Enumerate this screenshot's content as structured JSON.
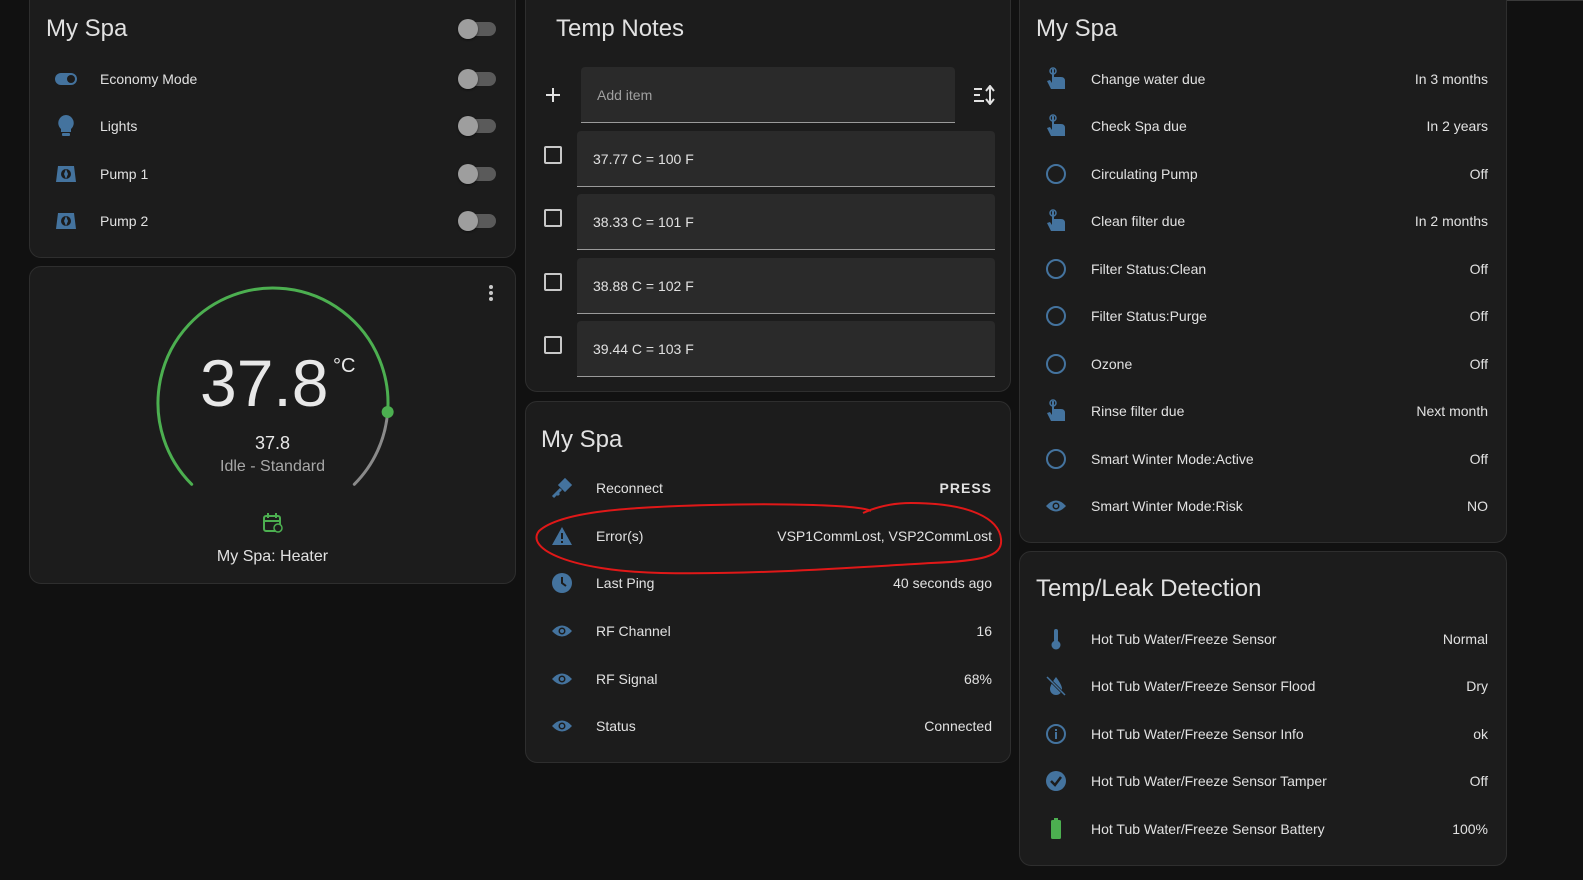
{
  "colors": {
    "icon": "#44739e",
    "accent": "#3d9ee8",
    "gauge": "#4caf50",
    "annotation": "#e01818"
  },
  "card1": {
    "title": "My Spa",
    "items": [
      {
        "label": "Economy Mode",
        "icon": "toggle-icon"
      },
      {
        "label": "Lights",
        "icon": "lightbulb-icon"
      },
      {
        "label": "Pump 1",
        "icon": "pump-icon"
      },
      {
        "label": "Pump 2",
        "icon": "pump-icon"
      }
    ]
  },
  "thermostat": {
    "temp": "37.8",
    "unit": "°C",
    "current": "37.8",
    "status": "Idle - Standard",
    "name": "My Spa: Heater",
    "gauge_fraction": 0.85
  },
  "notes": {
    "title": "Temp Notes",
    "add_placeholder": "Add item",
    "items": [
      "37.77 C = 100 F",
      "38.33 C = 101 F",
      "38.88 C = 102 F",
      "39.44 C = 103 F"
    ]
  },
  "spa2": {
    "title": "My Spa",
    "rows": [
      {
        "label": "Reconnect",
        "value": "PRESS",
        "icon": "wrench-icon"
      },
      {
        "label": "Error(s)",
        "value": "VSP1CommLost, VSP2CommLost",
        "icon": "alert-icon"
      },
      {
        "label": "Last Ping",
        "value": "40 seconds ago",
        "icon": "clock-icon"
      },
      {
        "label": "RF Channel",
        "value": "16",
        "icon": "eye-icon"
      },
      {
        "label": "RF Signal",
        "value": "68%",
        "icon": "eye-icon"
      },
      {
        "label": "Status",
        "value": "Connected",
        "icon": "eye-icon"
      }
    ]
  },
  "spa3": {
    "title": "My Spa",
    "rows": [
      {
        "label": "Change water due",
        "value": "In 3 months",
        "icon": "hand-icon"
      },
      {
        "label": "Check Spa due",
        "value": "In 2 years",
        "icon": "hand-icon"
      },
      {
        "label": "Circulating Pump",
        "value": "Off",
        "icon": "circle-icon"
      },
      {
        "label": "Clean filter due",
        "value": "In 2 months",
        "icon": "hand-icon"
      },
      {
        "label": "Filter Status:Clean",
        "value": "Off",
        "icon": "circle-icon"
      },
      {
        "label": "Filter Status:Purge",
        "value": "Off",
        "icon": "circle-icon"
      },
      {
        "label": "Ozone",
        "value": "Off",
        "icon": "circle-icon"
      },
      {
        "label": "Rinse filter due",
        "value": "Next month",
        "icon": "hand-icon"
      },
      {
        "label": "Smart Winter Mode:Active",
        "value": "Off",
        "icon": "circle-icon"
      },
      {
        "label": "Smart Winter Mode:Risk",
        "value": "NO",
        "icon": "eye-icon"
      }
    ]
  },
  "leak": {
    "title": "Temp/Leak Detection",
    "rows": [
      {
        "label": "Hot Tub Water/Freeze Sensor",
        "value": "Normal",
        "icon": "thermometer-icon"
      },
      {
        "label": "Hot Tub Water/Freeze Sensor Flood",
        "value": "Dry",
        "icon": "water-off-icon"
      },
      {
        "label": "Hot Tub Water/Freeze Sensor Info",
        "value": "ok",
        "icon": "info-icon"
      },
      {
        "label": "Hot Tub Water/Freeze Sensor Tamper",
        "value": "Off",
        "icon": "check-circle-icon"
      },
      {
        "label": "Hot Tub Water/Freeze Sensor Battery",
        "value": "100%",
        "icon": "battery-icon"
      }
    ]
  }
}
